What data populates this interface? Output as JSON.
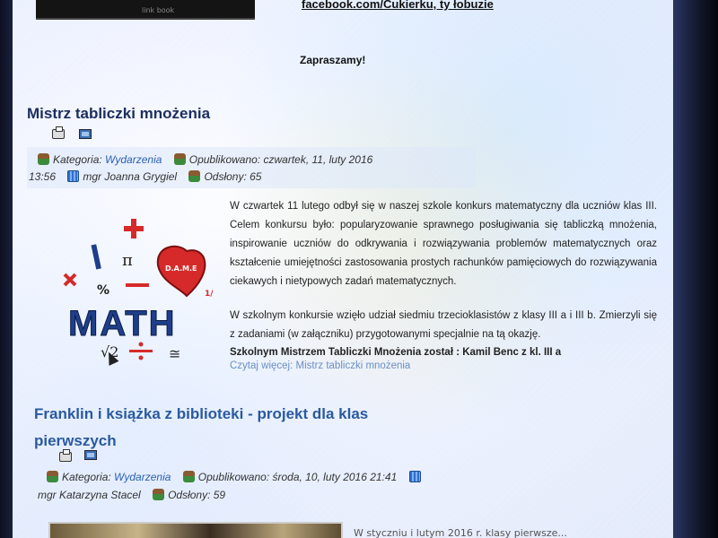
{
  "top": {
    "image_caption": "link book",
    "facebook_link": "facebook.com/Cukierku, ty łobuzie",
    "invite": "Zapraszamy!"
  },
  "article1": {
    "title": "Mistrz tabliczki mnożenia",
    "meta": {
      "category_label": "Kategoria:",
      "category": "Wydarzenia",
      "published_label": "Opublikowano:",
      "published": "czwartek, 11, luty 2016",
      "time": "13:56",
      "author": "mgr Joanna Grygiel",
      "views": "Odsłony: 65"
    },
    "paragraph1": "W czwartek 11 lutego odbył się w naszej szkole konkurs matematyczny dla uczniów klas III. Celem konkursu było: popularyzowanie sprawnego posługiwania się tabliczką mnożenia, inspirowanie uczniów do odkrywania i rozwiązywania problemów matematycznych oraz kształcenie umiejętności zastosowania prostych rachunków pamięciowych do rozwiązywania ciekawych i nietypowych zadań matematycznych.",
    "paragraph2": "W szkolnym konkursie wzięło udział siedmiu trzecioklasistów z klasy III a i III b. Zmierzyli się z zadaniami (w załączniku) przygotowanymi specjalnie na tą okazję.",
    "winner": "Szkolnym Mistrzem Tabliczki Mnożenia został : Kamil Benc z kl. III a",
    "read_more": "Czytaj więcej: Mistrz tabliczki mnożenia",
    "logo": {
      "word": "MATH",
      "letter": "I",
      "heart_text": "D.A.M.E",
      "pi": "π",
      "percent": "%",
      "half": "1/2",
      "sqrt": "√2",
      "approx": "≅"
    }
  },
  "article2": {
    "title": "Franklin i książka z biblioteki - projekt dla klas pierwszych",
    "meta": {
      "category_label": "Kategoria:",
      "category": "Wydarzenia",
      "published_label": "Opublikowano:",
      "published": "środa, 10, luty 2016 21:41",
      "author": "mgr Katarzyna Stacel",
      "views": "Odsłony: 59"
    },
    "preview_text": "W styczniu i lutym 2016 r. klasy pierwsze..."
  },
  "colors": {
    "title": "#1c2d5e",
    "link": "#2b62b0",
    "heart": "#d62a2a",
    "math_blue": "#1e3f8a"
  }
}
